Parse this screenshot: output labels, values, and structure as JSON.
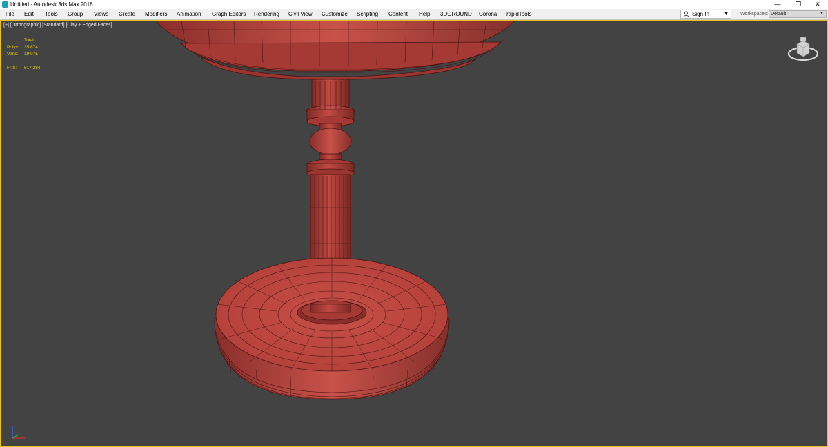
{
  "window": {
    "title": "Untitled - Autodesk 3ds Max 2018",
    "controls": [
      "—",
      "❐",
      "✕"
    ]
  },
  "menubar": {
    "items": [
      "File",
      "Edit",
      "Tools",
      "Group",
      "Views",
      "Create",
      "Modifiers",
      "Animation",
      "Graph Editors",
      "Rendering",
      "Civil View",
      "Customize",
      "Scripting",
      "Content",
      "Help",
      "3DGROUND",
      "Corona",
      "rapidTools"
    ]
  },
  "account": {
    "sign_in": "Sign In",
    "icon": "user-icon"
  },
  "workspaces": {
    "label": "Workspaces:",
    "selected": "Default"
  },
  "viewport": {
    "label": "[+] [Orthographic] [Standard] [Clay + Edged Faces]",
    "active_border_color": "#e8c21a",
    "stats": {
      "header": "Total",
      "polys_label": "Polys:",
      "polys_value": "35 874",
      "verts_label": "Verts:",
      "verts_value": "19 075",
      "fps_label": "FPS:",
      "fps_value": "617,284"
    },
    "model_color": "#b9413a",
    "wire_color": "#4a1412"
  },
  "icons": [
    "app-icon",
    "user-icon",
    "dropdown-arrow-icon",
    "viewcube-icon",
    "axis-tripod-icon"
  ]
}
